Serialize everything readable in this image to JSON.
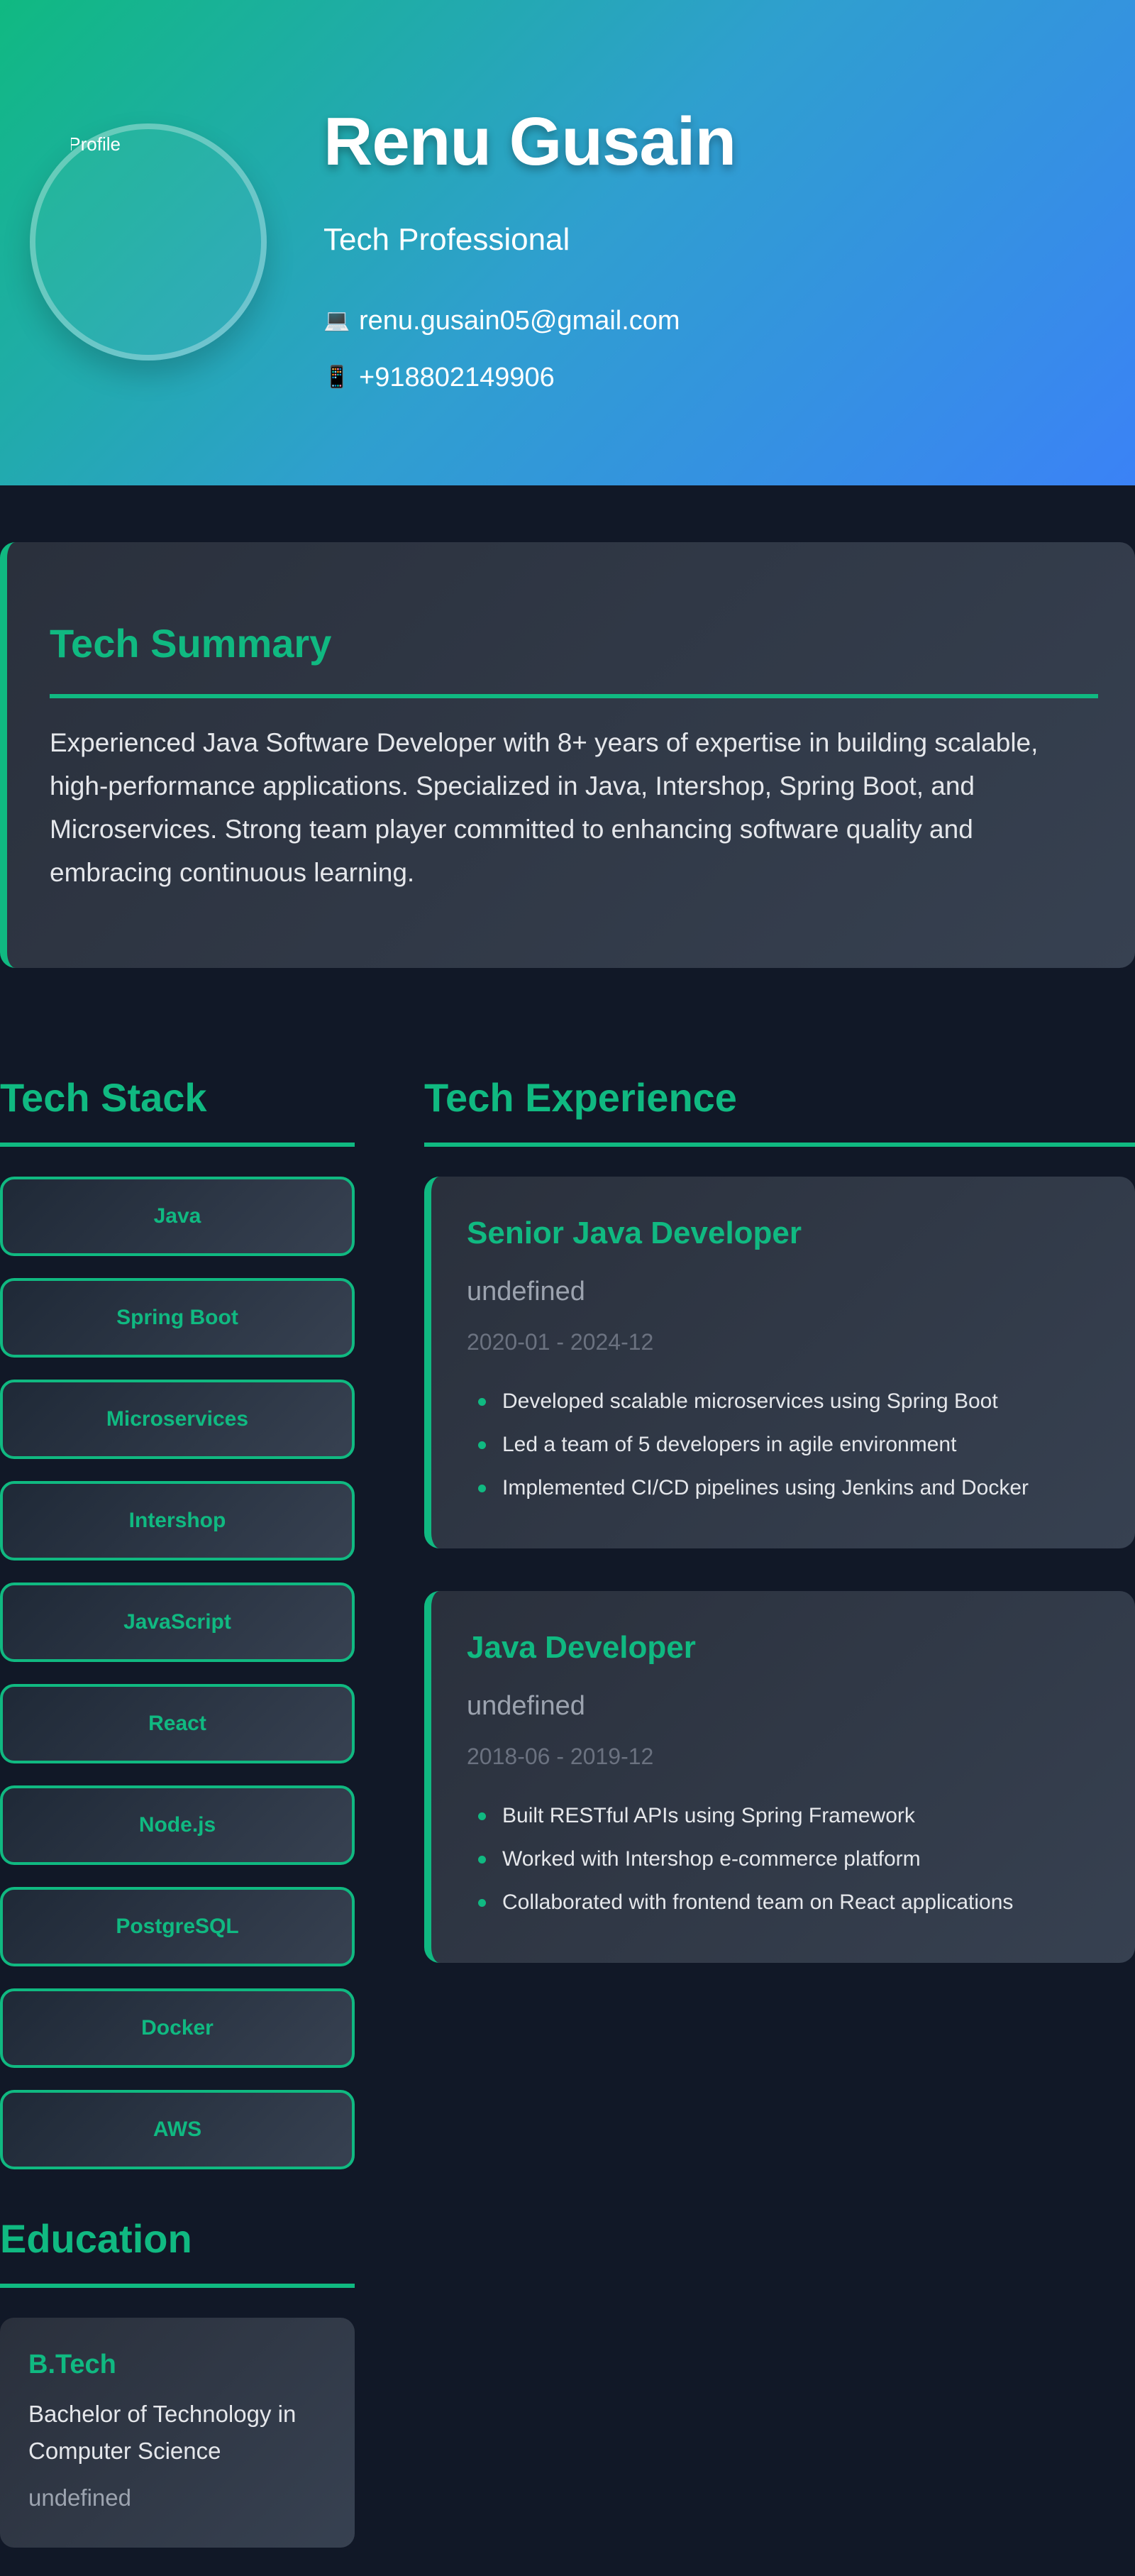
{
  "header": {
    "avatar_alt": "Profile",
    "name": "Renu Gusain",
    "role": "Tech Professional",
    "email": "renu.gusain05@gmail.com",
    "phone": "+918802149906",
    "email_icon": "💻",
    "phone_icon": "📱"
  },
  "summary": {
    "title": "Tech Summary",
    "text": "Experienced Java Software Developer with 8+ years of expertise in building scalable, high-performance applications. Specialized in Java, Intershop, Spring Boot, and Microservices. Strong team player committed to enhancing software quality and embracing continuous learning."
  },
  "skills": {
    "title": "Tech Stack",
    "items": [
      "Java",
      "Spring Boot",
      "Microservices",
      "Intershop",
      "JavaScript",
      "React",
      "Node.js",
      "PostgreSQL",
      "Docker",
      "AWS"
    ]
  },
  "experience": {
    "title": "Tech Experience",
    "items": [
      {
        "title": "Senior Java Developer",
        "company": "undefined",
        "dates": "2020-01 - 2024-12",
        "bullets": [
          "Developed scalable microservices using Spring Boot",
          "Led a team of 5 developers in agile environment",
          "Implemented CI/CD pipelines using Jenkins and Docker"
        ]
      },
      {
        "title": "Java Developer",
        "company": "undefined",
        "dates": "2018-06 - 2019-12",
        "bullets": [
          "Built RESTful APIs using Spring Framework",
          "Worked with Intershop e-commerce platform",
          "Collaborated with frontend team on React applications"
        ]
      }
    ]
  },
  "education": {
    "title": "Education",
    "items": [
      {
        "degree": "B.Tech",
        "field": "Bachelor of Technology in Computer Science",
        "school": "undefined"
      }
    ]
  },
  "colors": {
    "accent": "#10b981",
    "background": "#111827",
    "card": "#374151",
    "header_gradient_start": "#10b981",
    "header_gradient_end": "#3b82f6"
  }
}
